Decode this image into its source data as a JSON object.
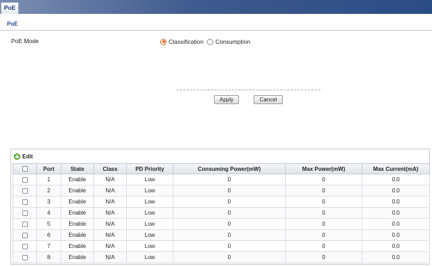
{
  "tabs": [
    {
      "label": "PoE",
      "active": true
    }
  ],
  "section": {
    "title": "PoE"
  },
  "poe_mode": {
    "label": "PoE Mode",
    "options": [
      {
        "label": "Classification",
        "checked": true
      },
      {
        "label": "Consumption",
        "checked": false
      }
    ]
  },
  "buttons": {
    "apply": "Apply",
    "cancel": "Cancel"
  },
  "table": {
    "edit_label": "Edit",
    "columns": [
      "Port",
      "State",
      "Class",
      "PD Priority",
      "Consuming Power(mW)",
      "Max Power(mW)",
      "Max Current(mA)"
    ],
    "rows": [
      {
        "port": "1",
        "state": "Enable",
        "class": "N/A",
        "priority": "Low",
        "consuming": "0",
        "max_power": "0",
        "max_current": "0.0"
      },
      {
        "port": "2",
        "state": "Enable",
        "class": "N/A",
        "priority": "Low",
        "consuming": "0",
        "max_power": "0",
        "max_current": "0.0"
      },
      {
        "port": "3",
        "state": "Enable",
        "class": "N/A",
        "priority": "Low",
        "consuming": "0",
        "max_power": "0",
        "max_current": "0.0"
      },
      {
        "port": "4",
        "state": "Enable",
        "class": "N/A",
        "priority": "Low",
        "consuming": "0",
        "max_power": "0",
        "max_current": "0.0"
      },
      {
        "port": "5",
        "state": "Enable",
        "class": "N/A",
        "priority": "Low",
        "consuming": "0",
        "max_power": "0",
        "max_current": "0.0"
      },
      {
        "port": "6",
        "state": "Enable",
        "class": "N/A",
        "priority": "Low",
        "consuming": "0",
        "max_power": "0",
        "max_current": "0.0"
      },
      {
        "port": "7",
        "state": "Enable",
        "class": "N/A",
        "priority": "Low",
        "consuming": "0",
        "max_power": "0",
        "max_current": "0.0"
      },
      {
        "port": "8",
        "state": "Enable",
        "class": "N/A",
        "priority": "Low",
        "consuming": "0",
        "max_power": "0",
        "max_current": "0.0"
      }
    ]
  },
  "colors": {
    "header_bar": "#2a4c84",
    "section_title": "#1d4b8f",
    "radio_selected": "#e2661c",
    "edit_icon": "#6abf3a"
  }
}
